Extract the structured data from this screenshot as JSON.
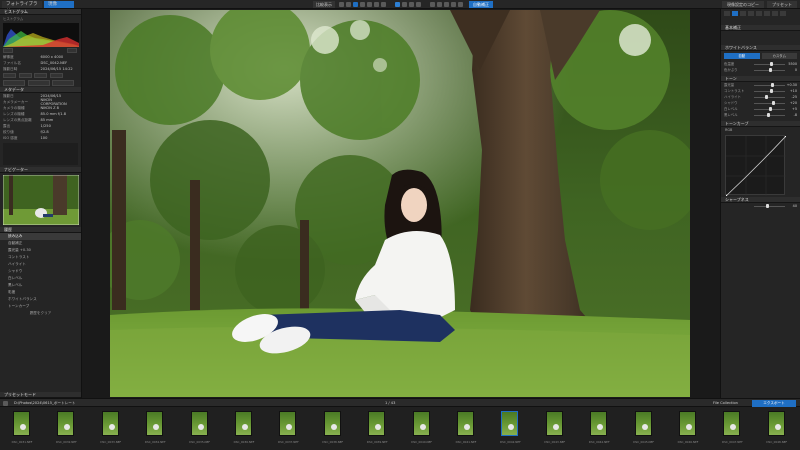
{
  "topbar": {
    "tab_library": "フォトライブラリ",
    "tab_develop": "現像",
    "center_label": "比較表示",
    "active_label": "自動補正",
    "batch_label": "現像設定のコピー",
    "batch2_label": "プリセット"
  },
  "left": {
    "histogram_header": "ヒストグラム",
    "hist_sub": "ヒストグラム",
    "info_rows": [
      {
        "k": "解像度",
        "v": "6000 x 4000"
      },
      {
        "k": "ファイル名",
        "v": "DSC_0042.NEF"
      },
      {
        "k": "撮影日時",
        "v": "2024/06/15 14:22"
      }
    ],
    "meta_header": "メタデータ",
    "meta_rows": [
      {
        "k": "撮影日",
        "v": "2024/06/15"
      },
      {
        "k": "カメラメーカー",
        "v": "NIKON CORPORATION"
      },
      {
        "k": "カメラの機種",
        "v": "NIKON Z 8"
      },
      {
        "k": "レンズの機種",
        "v": "85.0 mm f/1.8"
      },
      {
        "k": "レンズの焦点距離",
        "v": "85 mm"
      },
      {
        "k": "露出",
        "v": "1/250"
      },
      {
        "k": "絞り値",
        "v": "f/2.8"
      },
      {
        "k": "ISO 感度",
        "v": "100"
      }
    ],
    "navigator_header": "ナビゲーター",
    "history_header": "履歴",
    "history_items": [
      "読み込み",
      "自動補正",
      "露光量 +0.30",
      "コントラスト",
      "ハイライト",
      "シャドウ",
      "白レベル",
      "黒レベル",
      "彩度",
      "ホワイトバランス",
      "トーンカーブ"
    ],
    "history_footer": "履歴をクリア",
    "bottom_header": "プリセットモード"
  },
  "right": {
    "header": "基本補正",
    "sec1": "ホワイトバランス",
    "btn_auto": "自動",
    "btn_custom": "カスタム",
    "sliders1": [
      {
        "label": "色温度",
        "value": "5500",
        "pos": 0.55
      },
      {
        "label": "色かぶり",
        "value": "0",
        "pos": 0.5
      }
    ],
    "sec2": "トーン",
    "sliders2": [
      {
        "label": "露光量",
        "value": "+0.30",
        "pos": 0.58
      },
      {
        "label": "コントラスト",
        "value": "+10",
        "pos": 0.55
      },
      {
        "label": "ハイライト",
        "value": "-25",
        "pos": 0.4
      },
      {
        "label": "シャドウ",
        "value": "+20",
        "pos": 0.6
      },
      {
        "label": "白レベル",
        "value": "+5",
        "pos": 0.52
      },
      {
        "label": "黒レベル",
        "value": "-8",
        "pos": 0.46
      }
    ],
    "sec3": "トーンカーブ",
    "curve_label": "RGB",
    "sec4": "シャープネス",
    "sharp_value": "40"
  },
  "filmbar": {
    "path": "D:\\Photos\\2024\\0615_ポートレート",
    "count": "1 / 43",
    "collection": "File Collection",
    "export": "エクスポート"
  },
  "filmstrip": {
    "items": [
      "DSC_0031.NEF",
      "DSC_0032.NEF",
      "DSC_0033.NEF",
      "DSC_0034.NEF",
      "DSC_0035.NEF",
      "DSC_0036.NEF",
      "DSC_0037.NEF",
      "DSC_0038.NEF",
      "DSC_0039.NEF",
      "DSC_0040.NEF",
      "DSC_0041.NEF",
      "DSC_0042.NEF",
      "DSC_0043.NEF",
      "DSC_0044.NEF",
      "DSC_0045.NEF",
      "DSC_0046.NEF",
      "DSC_0047.NEF",
      "DSC_0048.NEF"
    ]
  },
  "colors": {
    "accent": "#1f6fc4",
    "panel": "#252525",
    "grass": "#6a9a35"
  }
}
